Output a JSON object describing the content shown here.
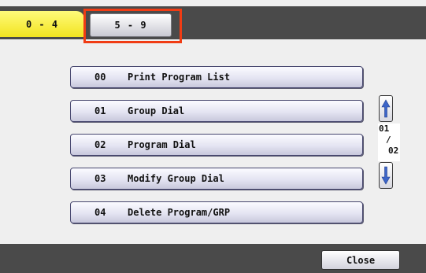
{
  "tabs": [
    {
      "label": "0 - 4",
      "state": "selected"
    },
    {
      "label": "5 - 9",
      "state": "unselected"
    }
  ],
  "programs": [
    {
      "number": "00",
      "label": "Print Program List"
    },
    {
      "number": "01",
      "label": "Group Dial"
    },
    {
      "number": "02",
      "label": "Program Dial"
    },
    {
      "number": "03",
      "label": "Modify Group Dial"
    },
    {
      "number": "04",
      "label": "Delete Program/GRP"
    }
  ],
  "pager": {
    "current": "01",
    "separator": "/",
    "total": "02",
    "up_icon": "arrow-up-icon",
    "down_icon": "arrow-down-icon"
  },
  "footer": {
    "close_label": "Close"
  },
  "colors": {
    "header": "#4a4a4a",
    "active_tab": "#f6ec30",
    "highlight": "#f03c14",
    "button_border": "#46466e",
    "arrow": "#3c64c8"
  }
}
